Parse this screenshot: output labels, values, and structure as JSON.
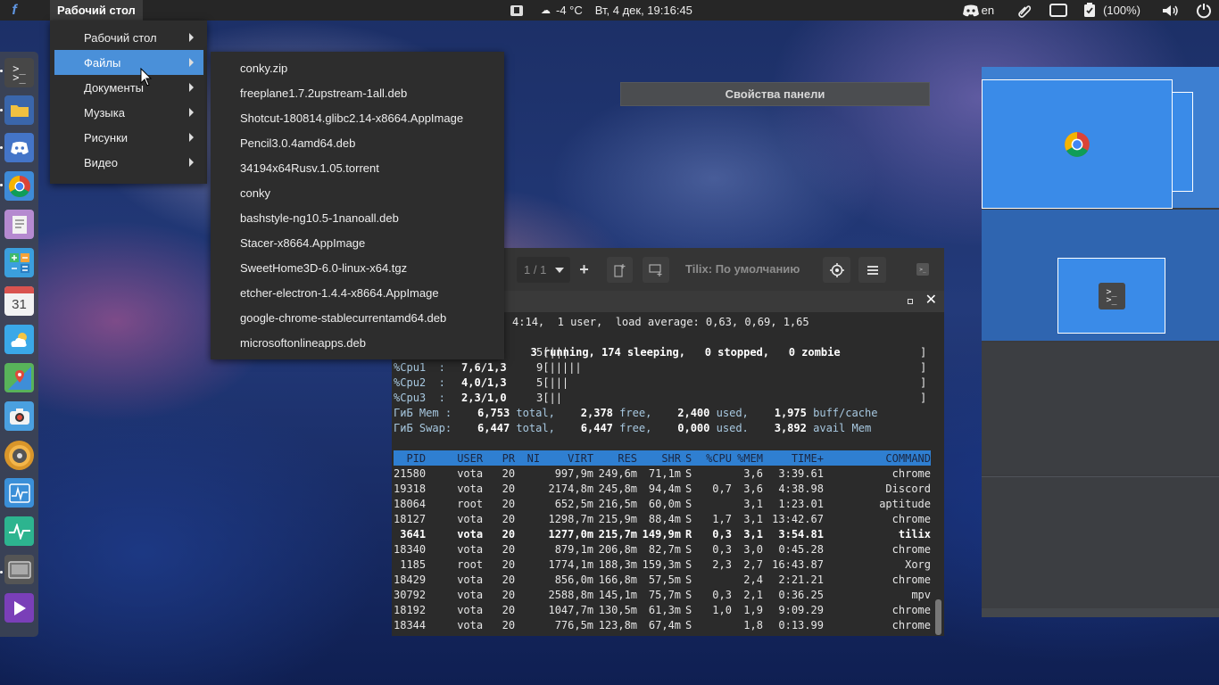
{
  "topbar": {
    "app_menu": "Рабочий стол",
    "weather": "-4 °C",
    "datetime": "Вт,  4 дек, 19:16:45",
    "keyboard_layout": "en",
    "battery": "(100%)"
  },
  "menu_places": {
    "items": [
      {
        "label": "Рабочий стол"
      },
      {
        "label": "Файлы"
      },
      {
        "label": "Документы"
      },
      {
        "label": "Музыка"
      },
      {
        "label": "Рисунки"
      },
      {
        "label": "Видео"
      }
    ],
    "selected": "Файлы"
  },
  "menu_files": {
    "items": [
      "conky.zip",
      "freeplane1.7.2upstream-1all.deb",
      "Shotcut-180814.glibc2.14-x8664.AppImage",
      "Pencil3.0.4amd64.deb",
      "34194x64Rusv.1.05.torrent",
      "conky",
      "bashstyle-ng10.5-1nanoall.deb",
      "Stacer-x8664.AppImage",
      "SweetHome3D-6.0-linux-x64.tgz",
      "etcher-electron-1.4.4-x8664.AppImage",
      "google-chrome-stablecurrentamd64.deb",
      "microsoftonlineapps.deb"
    ]
  },
  "panel_properties": {
    "title": "Свойства панели"
  },
  "tilix": {
    "session_counter": "1 / 1",
    "title": "Tilix: По умолчанию"
  },
  "top": {
    "uptime_line": "4:14,  1 user,  load average: 0,63, 0,69, 1,65",
    "tasks_line": "3 running, 174 sleeping,   0 stopped,   0 zombie",
    "cpu_lines": [
      {
        "label": "",
        "val": "",
        "bars": "5[|||",
        "end": "]"
      },
      {
        "label": "%Cpu1  :",
        "val": "7,6/1,3",
        "bars": "9[|||||",
        "end": "]"
      },
      {
        "label": "%Cpu2  :",
        "val": "4,0/1,3",
        "bars": "5[|||",
        "end": "]"
      },
      {
        "label": "%Cpu3  :",
        "val": "2,3/1,0",
        "bars": "3[||",
        "end": "]"
      }
    ],
    "mem_line": {
      "label": "ГиБ Mem :",
      "total": "6,753",
      "free": "2,378",
      "used": "2,400",
      "buff": "1,975"
    },
    "swap_line": {
      "label": "ГиБ Swap:",
      "total": "6,447",
      "free": "6,447",
      "used": "0,000",
      "avail": "3,892"
    },
    "mem_words": {
      "total": "total,",
      "free": "free,",
      "used": "used,",
      "buff": "buff/cache",
      "used_dot": "used.",
      "avail": "avail Mem"
    },
    "columns": [
      "PID",
      "USER",
      "PR",
      "NI",
      "VIRT",
      "RES",
      "SHR",
      "S",
      "%CPU",
      "%MEM",
      "TIME+",
      "COMMAND"
    ],
    "rows": [
      [
        "21580",
        "vota",
        "20",
        "",
        "997,9m",
        "249,6m",
        "71,1m",
        "S",
        "",
        "3,6",
        "3:39.61",
        "chrome"
      ],
      [
        "19318",
        "vota",
        "20",
        "",
        "2174,8m",
        "245,8m",
        "94,4m",
        "S",
        "0,7",
        "3,6",
        "4:38.98",
        "Discord"
      ],
      [
        "18064",
        "root",
        "20",
        "",
        "652,5m",
        "216,5m",
        "60,0m",
        "S",
        "",
        "3,1",
        "1:23.01",
        "aptitude"
      ],
      [
        "18127",
        "vota",
        "20",
        "",
        "1298,7m",
        "215,9m",
        "88,4m",
        "S",
        "1,7",
        "3,1",
        "13:42.67",
        "chrome"
      ],
      [
        "3641",
        "vota",
        "20",
        "",
        "1277,0m",
        "215,7m",
        "149,9m",
        "R",
        "0,3",
        "3,1",
        "3:54.81",
        "tilix"
      ],
      [
        "18340",
        "vota",
        "20",
        "",
        "879,1m",
        "206,8m",
        "82,7m",
        "S",
        "0,3",
        "3,0",
        "0:45.28",
        "chrome"
      ],
      [
        "1185",
        "root",
        "20",
        "",
        "1774,1m",
        "188,3m",
        "159,3m",
        "S",
        "2,3",
        "2,7",
        "16:43.87",
        "Xorg"
      ],
      [
        "18429",
        "vota",
        "20",
        "",
        "856,0m",
        "166,8m",
        "57,5m",
        "S",
        "",
        "2,4",
        "2:21.21",
        "chrome"
      ],
      [
        "30792",
        "vota",
        "20",
        "",
        "2588,8m",
        "145,1m",
        "75,7m",
        "S",
        "0,3",
        "2,1",
        "0:36.25",
        "mpv"
      ],
      [
        "18192",
        "vota",
        "20",
        "",
        "1047,7m",
        "130,5m",
        "61,3m",
        "S",
        "1,0",
        "1,9",
        "9:09.29",
        "chrome"
      ],
      [
        "18344",
        "vota",
        "20",
        "",
        "776,5m",
        "123,8m",
        "67,4m",
        "S",
        "",
        "1,8",
        "0:13.99",
        "chrome"
      ]
    ],
    "bold_row": 4
  },
  "dock": {
    "items": [
      {
        "icon": "terminal-icon",
        "color": "#3b3b3b"
      },
      {
        "icon": "folder-icon",
        "color": "#3d6fb8"
      },
      {
        "icon": "discord-icon",
        "color": "#4a7cd3"
      },
      {
        "icon": "chrome-icon",
        "color": "#e8e8e8"
      },
      {
        "icon": "text-editor-icon",
        "color": "#b690cf"
      },
      {
        "icon": "calculator-icon",
        "color": "#3fa8e0"
      },
      {
        "icon": "calendar-icon",
        "color": "#f2f2f2"
      },
      {
        "icon": "weather-icon",
        "color": "#3aa8e8"
      },
      {
        "icon": "maps-icon",
        "color": "#5cb85c"
      },
      {
        "icon": "camera-icon",
        "color": "#4aa0e0"
      },
      {
        "icon": "audio-icon",
        "color": "#e0a030"
      },
      {
        "icon": "system-monitor-icon",
        "color": "#3a8fd8"
      },
      {
        "icon": "activity-icon",
        "color": "#30c0a0"
      },
      {
        "icon": "screen-icon",
        "color": "#555"
      },
      {
        "icon": "media-player-icon",
        "color": "#7a3fb8"
      }
    ]
  },
  "calendar_day": "31"
}
